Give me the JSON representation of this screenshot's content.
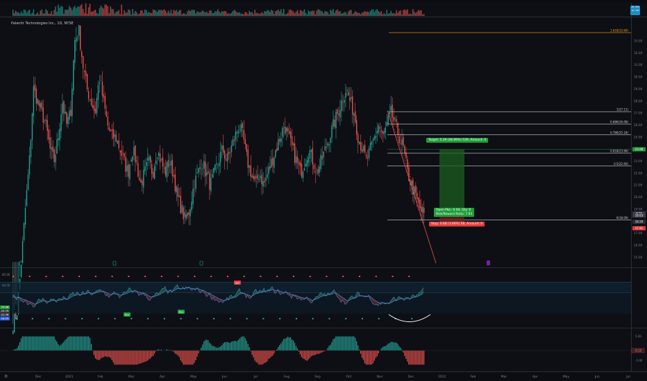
{
  "symbol_title": "Palantir Technologies Inc., 1D, NYSE",
  "top_badge": {
    "line1": "35.71M",
    "line2": "10.79M"
  },
  "colors": {
    "up": "#26a69a",
    "down": "#ef5350",
    "bg": "#0d0f14",
    "fib": "#d1d4dc",
    "fib_top": "#f7a21b",
    "trend": "#ef5350",
    "target_zone": "#1f6b2a",
    "stop_zone": "#6b1f1f"
  },
  "price_axis": [
    "33.00",
    "32.00",
    "31.00",
    "30.00",
    "29.00",
    "28.00",
    "27.00",
    "26.00",
    "25.00",
    "24.00",
    "23.00",
    "22.00",
    "21.00",
    "20.00",
    "19.00",
    "18.00",
    "17.00",
    "16.00",
    "15.00"
  ],
  "fib_levels": [
    {
      "label": "1.618(33.69)",
      "price": 33.69,
      "top": true
    },
    {
      "label": "1(27.11)",
      "price": 27.11
    },
    {
      "label": "0.886(26.08)",
      "price": 26.08
    },
    {
      "label": "0.786(25.18)",
      "price": 25.18
    },
    {
      "label": "0.618(23.66)",
      "price": 23.66
    },
    {
      "label": "0.5(22.60)",
      "price": 22.6
    },
    {
      "label": "0(18.09)",
      "price": 18.09
    }
  ],
  "position": {
    "target_label": "Target: 5.39 (28.99%) 539, Amount: 0",
    "open_label_1": "Open P&L: 0.04, Qty: 0",
    "open_label_2": "Risk/Reward Ratio: 7.93",
    "stop_label": "Stop: 0.68 (3.66%) 68, Amount: 0"
  },
  "price_tags": [
    {
      "text": "23.98",
      "price": 23.98,
      "color": "#1e9e3a"
    },
    {
      "text": "PLTR",
      "price": 18.63,
      "color": "#3a3d46"
    },
    {
      "text": "18.63",
      "price": 18.47,
      "color": "#3a3d46"
    },
    {
      "text": "18.59",
      "price": 17.95,
      "color": "#2a2d36"
    },
    {
      "text": "17.91",
      "price": 17.41,
      "color": "#e23b3b"
    }
  ],
  "indicator1": {
    "levels": [
      "80.00",
      "60.00"
    ],
    "tags": [
      {
        "text": "29.98",
        "color": "#1e9e3a"
      },
      {
        "text": "23.79",
        "color": "#3a3d46"
      },
      {
        "text": "21.78",
        "color": "#3a3d46"
      },
      {
        "text": "18.25",
        "color": "#2962ff"
      }
    ],
    "labels": [
      "Sell",
      "Buy",
      "Buy"
    ]
  },
  "indicator2": {
    "levels": [
      "5.00",
      "-5.00"
    ],
    "tag": "-0.15"
  },
  "time_axis": [
    "Dec",
    "2021",
    "Feb",
    "Mar",
    "Apr",
    "May",
    "Jun",
    "Jul",
    "Aug",
    "Sep",
    "Oct",
    "Nov",
    "Dec",
    "2022",
    "Feb",
    "Mar",
    "Apr",
    "May",
    "Jun",
    "Jul"
  ],
  "chart_data": {
    "type": "candlestick",
    "title": "Palantir Technologies Inc., 1D, NYSE",
    "ylim": [
      14.5,
      34.5
    ],
    "closes_approx": [
      9.5,
      10.5,
      14.5,
      19,
      23,
      29,
      28,
      27,
      26,
      24,
      23,
      25,
      28,
      26,
      27,
      33,
      34,
      31,
      29,
      28,
      27,
      30,
      28,
      26,
      25,
      25,
      24,
      23,
      22,
      24,
      23,
      21,
      22,
      23,
      22,
      24,
      23,
      22,
      23,
      22,
      20,
      19,
      18,
      19,
      21,
      22,
      23,
      22,
      21,
      22,
      23,
      24,
      23,
      24,
      25,
      26,
      25,
      23,
      22,
      21,
      22,
      21,
      22,
      23,
      24,
      25,
      26,
      25,
      24,
      23,
      22,
      23,
      24,
      23,
      22,
      23,
      24,
      25,
      26,
      27,
      28,
      29,
      28,
      27,
      25,
      24,
      23,
      24,
      25,
      26,
      25,
      26,
      27,
      26,
      25,
      24,
      22,
      21,
      20,
      19,
      18.6
    ]
  }
}
